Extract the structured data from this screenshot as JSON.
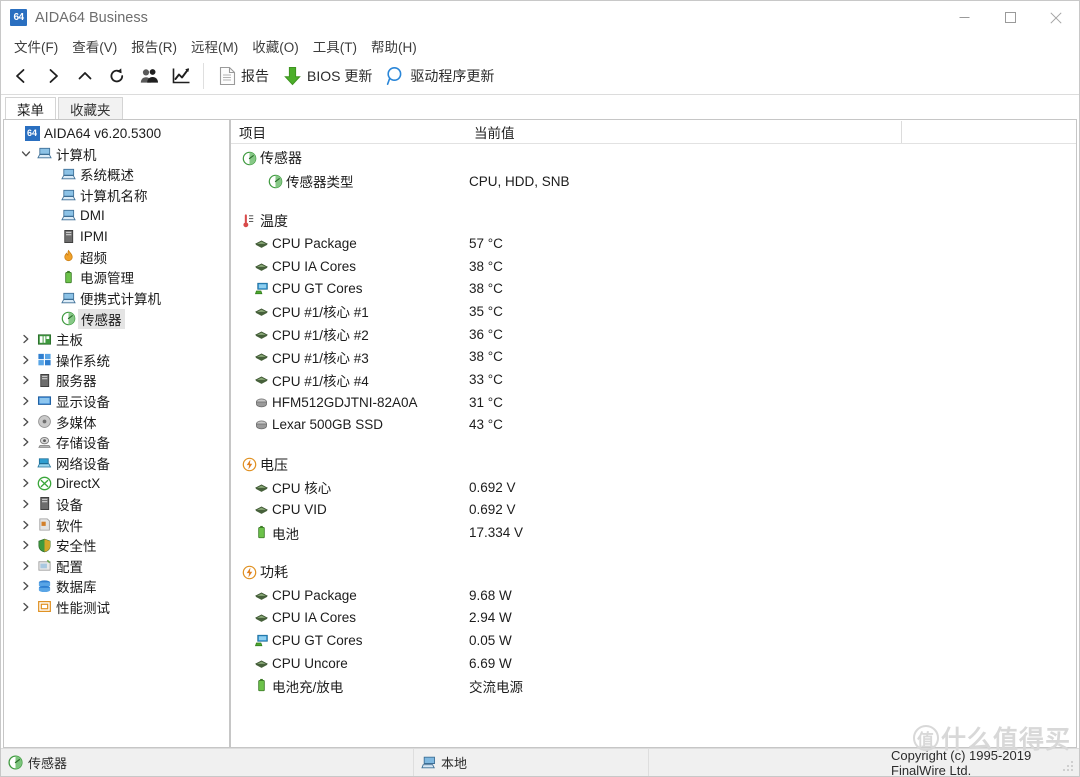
{
  "window": {
    "title": "AIDA64 Business",
    "badge": "64",
    "controls": {
      "minimize": "minimize-button",
      "maximize": "maximize-button",
      "close": "close-button"
    }
  },
  "menubar": [
    {
      "label": "文件(F)",
      "name": "menu-file"
    },
    {
      "label": "查看(V)",
      "name": "menu-view"
    },
    {
      "label": "报告(R)",
      "name": "menu-report"
    },
    {
      "label": "远程(M)",
      "name": "menu-remote"
    },
    {
      "label": "收藏(O)",
      "name": "menu-favorites"
    },
    {
      "label": "工具(T)",
      "name": "menu-tools"
    },
    {
      "label": "帮助(H)",
      "name": "menu-help"
    }
  ],
  "toolbar": {
    "icons": [
      "back-icon",
      "forward-icon",
      "up-icon",
      "refresh-icon",
      "users-icon",
      "chart-icon"
    ],
    "report_label": "报告",
    "bios_label": "BIOS 更新",
    "driver_label": "驱动程序更新"
  },
  "sidebar": {
    "tabs": [
      {
        "label": "菜单",
        "active": true
      },
      {
        "label": "收藏夹",
        "active": false
      }
    ],
    "root": "AIDA64 v6.20.5300",
    "items": [
      {
        "label": "计算机",
        "depth": 1,
        "chev": "expanded",
        "icon": "computer-icon"
      },
      {
        "label": "系统概述",
        "depth": 2,
        "chev": "none",
        "icon": "computer-icon"
      },
      {
        "label": "计算机名称",
        "depth": 2,
        "chev": "none",
        "icon": "computer-icon"
      },
      {
        "label": "DMI",
        "depth": 2,
        "chev": "none",
        "icon": "computer-icon"
      },
      {
        "label": "IPMI",
        "depth": 2,
        "chev": "none",
        "icon": "server-icon"
      },
      {
        "label": "超频",
        "depth": 2,
        "chev": "none",
        "icon": "flame-icon"
      },
      {
        "label": "电源管理",
        "depth": 2,
        "chev": "none",
        "icon": "battery-icon"
      },
      {
        "label": "便携式计算机",
        "depth": 2,
        "chev": "none",
        "icon": "laptop-icon"
      },
      {
        "label": "传感器",
        "depth": 2,
        "chev": "none",
        "icon": "sensor-icon",
        "selected": true
      },
      {
        "label": "主板",
        "depth": 1,
        "chev": "collapsed",
        "icon": "motherboard-icon"
      },
      {
        "label": "操作系统",
        "depth": 1,
        "chev": "collapsed",
        "icon": "windows-icon"
      },
      {
        "label": "服务器",
        "depth": 1,
        "chev": "collapsed",
        "icon": "server-icon"
      },
      {
        "label": "显示设备",
        "depth": 1,
        "chev": "collapsed",
        "icon": "display-icon"
      },
      {
        "label": "多媒体",
        "depth": 1,
        "chev": "collapsed",
        "icon": "multimedia-icon"
      },
      {
        "label": "存储设备",
        "depth": 1,
        "chev": "collapsed",
        "icon": "storage-icon"
      },
      {
        "label": "网络设备",
        "depth": 1,
        "chev": "collapsed",
        "icon": "network-icon"
      },
      {
        "label": "DirectX",
        "depth": 1,
        "chev": "collapsed",
        "icon": "directx-icon"
      },
      {
        "label": "设备",
        "depth": 1,
        "chev": "collapsed",
        "icon": "device-icon"
      },
      {
        "label": "软件",
        "depth": 1,
        "chev": "collapsed",
        "icon": "software-icon"
      },
      {
        "label": "安全性",
        "depth": 1,
        "chev": "collapsed",
        "icon": "shield-icon"
      },
      {
        "label": "配置",
        "depth": 1,
        "chev": "collapsed",
        "icon": "config-icon"
      },
      {
        "label": "数据库",
        "depth": 1,
        "chev": "collapsed",
        "icon": "database-icon"
      },
      {
        "label": "性能测试",
        "depth": 1,
        "chev": "collapsed",
        "icon": "benchmark-icon"
      }
    ]
  },
  "main": {
    "headers": {
      "item": "项目",
      "value": "当前值"
    },
    "rows": [
      {
        "kind": "group",
        "icon": "sensor-icon",
        "label": "传感器",
        "value": ""
      },
      {
        "kind": "sub",
        "icon": "sensor-icon",
        "label": "传感器类型",
        "value": "CPU, HDD, SNB"
      },
      {
        "kind": "spacer"
      },
      {
        "kind": "group",
        "icon": "thermometer-icon",
        "label": "温度",
        "value": ""
      },
      {
        "kind": "item",
        "icon": "cpu-icon",
        "label": "CPU Package",
        "value": "57 °C"
      },
      {
        "kind": "item",
        "icon": "cpu-icon",
        "label": "CPU IA Cores",
        "value": "38 °C"
      },
      {
        "kind": "item",
        "icon": "gpu-icon",
        "label": "CPU GT Cores",
        "value": "38 °C"
      },
      {
        "kind": "item",
        "icon": "cpu-icon",
        "label": "CPU #1/核心 #1",
        "value": "35 °C"
      },
      {
        "kind": "item",
        "icon": "cpu-icon",
        "label": "CPU #1/核心 #2",
        "value": "36 °C"
      },
      {
        "kind": "item",
        "icon": "cpu-icon",
        "label": "CPU #1/核心 #3",
        "value": "38 °C"
      },
      {
        "kind": "item",
        "icon": "cpu-icon",
        "label": "CPU #1/核心 #4",
        "value": "33 °C"
      },
      {
        "kind": "item",
        "icon": "drive-icon",
        "label": "HFM512GDJTNI-82A0A",
        "value": "31 °C"
      },
      {
        "kind": "item",
        "icon": "drive-icon",
        "label": "Lexar 500GB SSD",
        "value": "43 °C"
      },
      {
        "kind": "spacer"
      },
      {
        "kind": "group",
        "icon": "voltage-icon",
        "label": "电压",
        "value": ""
      },
      {
        "kind": "item",
        "icon": "cpu-icon",
        "label": "CPU 核心",
        "value": "0.692 V"
      },
      {
        "kind": "item",
        "icon": "cpu-icon",
        "label": "CPU VID",
        "value": "0.692 V"
      },
      {
        "kind": "item",
        "icon": "battery-icon",
        "label": "电池",
        "value": "17.334 V"
      },
      {
        "kind": "spacer"
      },
      {
        "kind": "group",
        "icon": "voltage-icon",
        "label": "功耗",
        "value": ""
      },
      {
        "kind": "item",
        "icon": "cpu-icon",
        "label": "CPU Package",
        "value": "9.68 W"
      },
      {
        "kind": "item",
        "icon": "cpu-icon",
        "label": "CPU IA Cores",
        "value": "2.94 W"
      },
      {
        "kind": "item",
        "icon": "gpu-icon",
        "label": "CPU GT Cores",
        "value": "0.05 W"
      },
      {
        "kind": "item",
        "icon": "cpu-icon",
        "label": "CPU Uncore",
        "value": "6.69 W"
      },
      {
        "kind": "item",
        "icon": "battery-icon",
        "label": "电池充/放电",
        "value": "交流电源"
      }
    ]
  },
  "statusbar": {
    "page": "传感器",
    "location": "本地",
    "copyright": "Copyright (c) 1995-2019 FinalWire Ltd."
  },
  "watermark": {
    "mark": "值",
    "text": "什么值得买"
  },
  "colors": {
    "accent": "#2a6fc0",
    "sensor_green": "#3f9a3f",
    "download_green": "#4caf2a",
    "selection_gray": "#e4e4e4"
  }
}
